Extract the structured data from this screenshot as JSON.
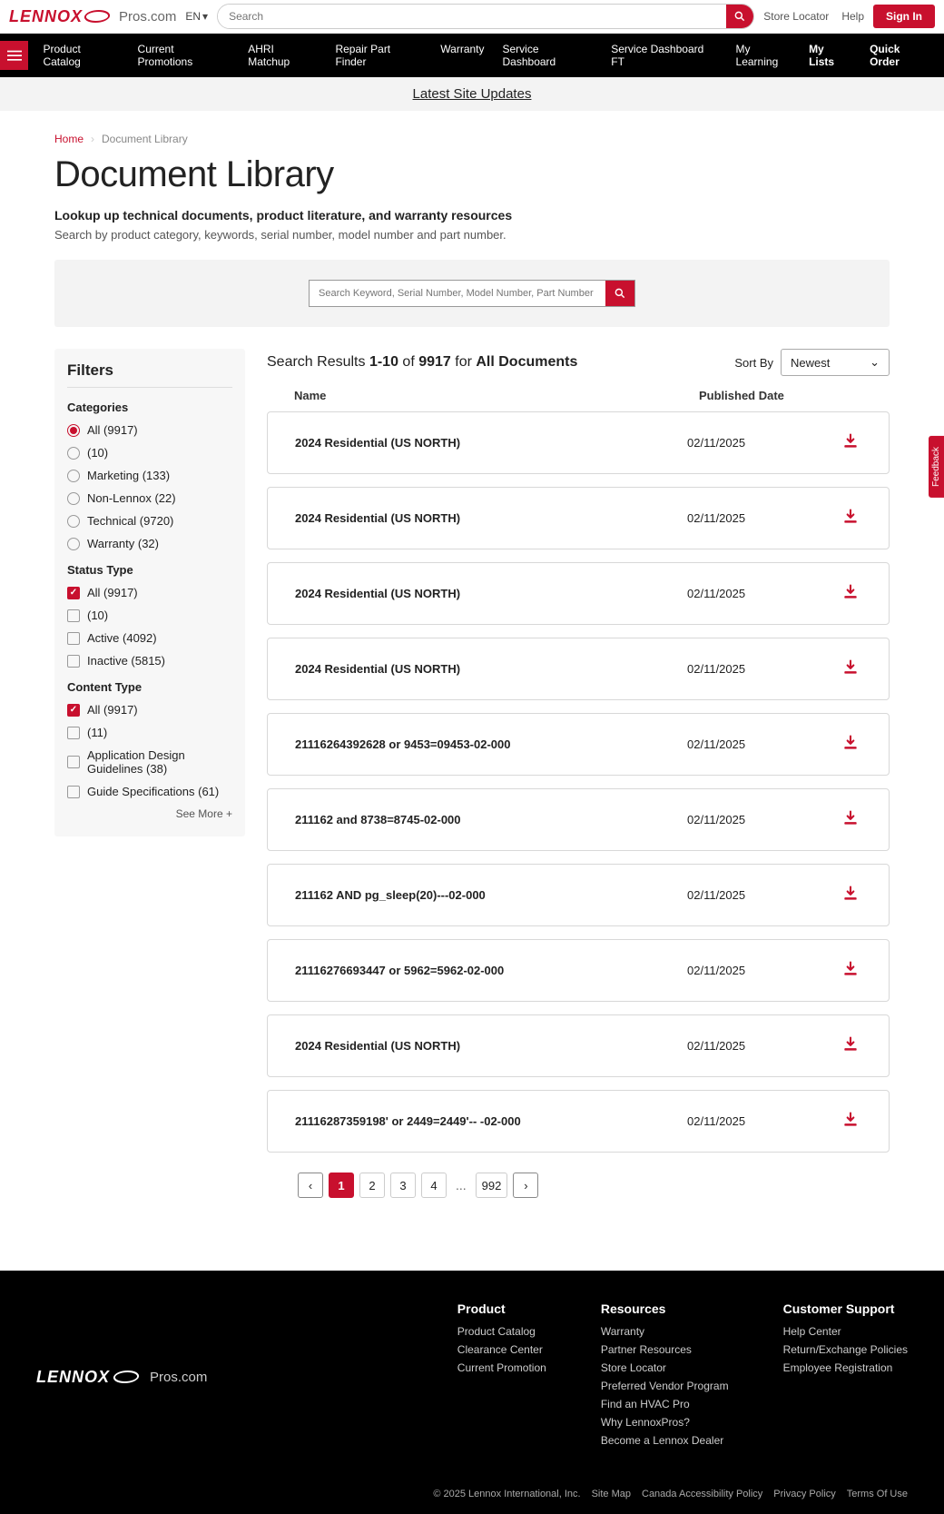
{
  "top": {
    "brand": "LENNOX",
    "pros": "Pros.com",
    "lang": "EN",
    "search_placeholder": "Search",
    "store_locator": "Store Locator",
    "help": "Help",
    "signin": "Sign In"
  },
  "nav": {
    "items": [
      "Product Catalog",
      "Current Promotions",
      "AHRI Matchup",
      "Repair Part Finder",
      "Warranty",
      "Service Dashboard",
      "Service Dashboard FT",
      "My Learning"
    ],
    "right": [
      "My Lists",
      "Quick Order"
    ]
  },
  "banner": "Latest Site Updates",
  "breadcrumb": {
    "home": "Home",
    "current": "Document Library"
  },
  "page": {
    "title": "Document Library",
    "subtitle": "Lookup up technical documents, product literature, and warranty resources",
    "desc": "Search by product category, keywords, serial number, model number and part number."
  },
  "doc_search_placeholder": "Search Keyword, Serial Number, Model Number, Part Number",
  "filters": {
    "title": "Filters",
    "categories_label": "Categories",
    "categories": [
      {
        "label": "All (9917)",
        "checked": true
      },
      {
        "label": " (10)",
        "checked": false
      },
      {
        "label": "Marketing (133)",
        "checked": false
      },
      {
        "label": "Non-Lennox (22)",
        "checked": false
      },
      {
        "label": "Technical (9720)",
        "checked": false
      },
      {
        "label": "Warranty (32)",
        "checked": false
      }
    ],
    "status_label": "Status Type",
    "status": [
      {
        "label": "All (9917)",
        "checked": true
      },
      {
        "label": " (10)",
        "checked": false
      },
      {
        "label": "Active (4092)",
        "checked": false
      },
      {
        "label": "Inactive (5815)",
        "checked": false
      }
    ],
    "content_label": "Content Type",
    "content": [
      {
        "label": "All (9917)",
        "checked": true
      },
      {
        "label": " (11)",
        "checked": false
      },
      {
        "label": "Application Design Guidelines (38)",
        "checked": false
      },
      {
        "label": "Guide Specifications (61)",
        "checked": false
      }
    ],
    "see_more": "See More"
  },
  "results": {
    "prefix": "Search Results ",
    "range": "1-10",
    "of": " of ",
    "total": "9917",
    "for": " for ",
    "scope": "All Documents",
    "sort_label": "Sort By",
    "sort_value": "Newest",
    "col_name": "Name",
    "col_date": "Published Date",
    "items": [
      {
        "name": "2024 Residential (US NORTH)",
        "date": "02/11/2025"
      },
      {
        "name": "2024 Residential (US NORTH)",
        "date": "02/11/2025"
      },
      {
        "name": "2024 Residential (US NORTH)",
        "date": "02/11/2025"
      },
      {
        "name": "2024 Residential (US NORTH)",
        "date": "02/11/2025"
      },
      {
        "name": "21116264392628 or 9453=09453-02-000",
        "date": "02/11/2025"
      },
      {
        "name": "211162 and 8738=8745-02-000",
        "date": "02/11/2025"
      },
      {
        "name": "211162 AND pg_sleep(20)---02-000",
        "date": "02/11/2025"
      },
      {
        "name": "21116276693447 or 5962=5962-02-000",
        "date": "02/11/2025"
      },
      {
        "name": "2024 Residential (US NORTH)",
        "date": "02/11/2025"
      },
      {
        "name": "21116287359198' or 2449=2449'-- -02-000",
        "date": "02/11/2025"
      }
    ]
  },
  "pagination": {
    "pages": [
      "1",
      "2",
      "3",
      "4"
    ],
    "ellipsis": "...",
    "last": "992"
  },
  "footer": {
    "brand": "LENNOX",
    "pros": "Pros.com",
    "cols": [
      {
        "title": "Product",
        "links": [
          "Product Catalog",
          "Clearance Center",
          "Current Promotion"
        ]
      },
      {
        "title": "Resources",
        "links": [
          "Warranty",
          "Partner Resources",
          "Store Locator",
          "Preferred Vendor Program",
          "Find an HVAC Pro",
          "Why LennoxPros?",
          "Become a Lennox Dealer"
        ]
      },
      {
        "title": "Customer Support",
        "links": [
          "Help Center",
          "Return/Exchange Policies",
          "Employee Registration"
        ]
      }
    ],
    "bottom": [
      "© 2025 Lennox International, Inc.",
      "Site Map",
      "Canada Accessibility Policy",
      "Privacy Policy",
      "Terms Of Use"
    ]
  },
  "feedback": "Feedback"
}
